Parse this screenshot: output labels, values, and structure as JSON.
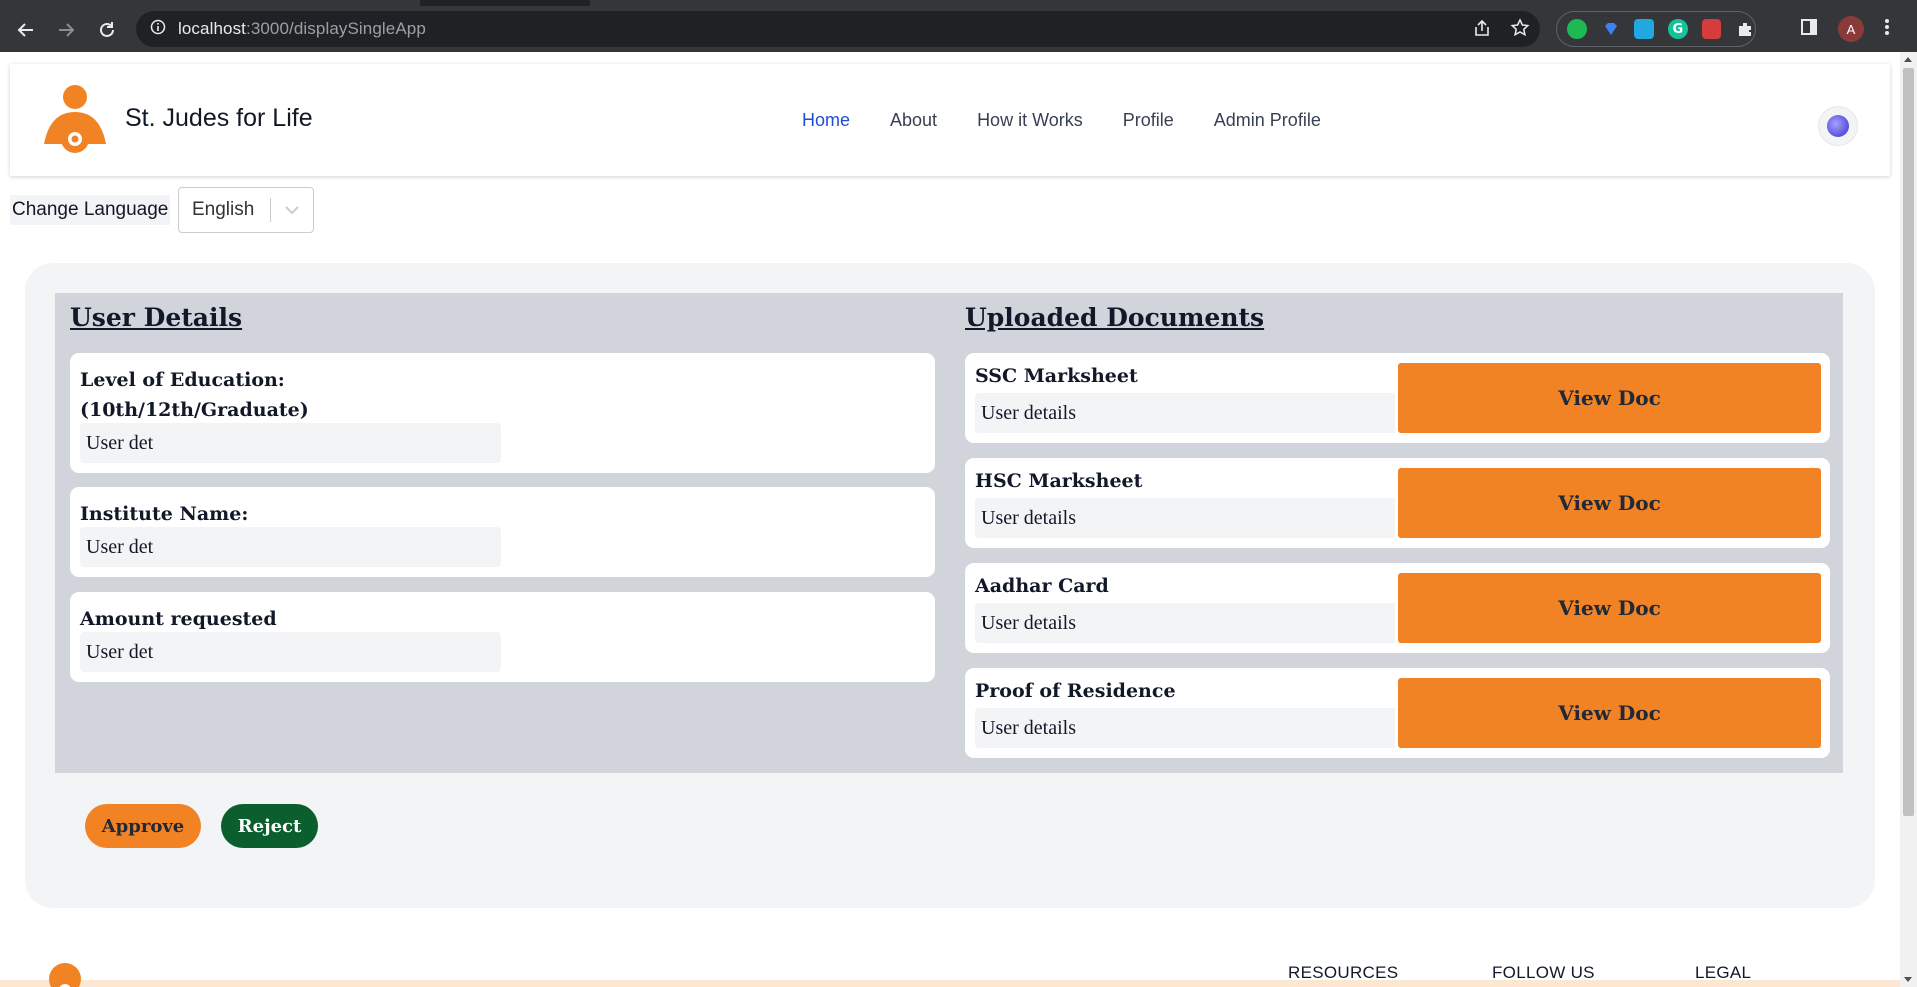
{
  "browser": {
    "url_host": "localhost",
    "url_rest": ":3000/displaySingleApp",
    "profile_initial": "A"
  },
  "header": {
    "brand": "St. Judes for Life",
    "nav": [
      "Home",
      "About",
      "How it Works",
      "Profile",
      "Admin Profile"
    ],
    "active_nav": "Home",
    "accent_color": "#1d4ed8"
  },
  "language": {
    "label": "Change Language",
    "selected": "English"
  },
  "user_details": {
    "title": "User Details",
    "fields": [
      {
        "label": "Level of Education: (10th/12th/Graduate)",
        "value": "User det"
      },
      {
        "label": "Institute Name:",
        "value": "User det"
      },
      {
        "label": "Amount requested",
        "value": "User det"
      }
    ]
  },
  "documents": {
    "title": "Uploaded Documents",
    "items": [
      {
        "label": "SSC Marksheet",
        "value": "User details",
        "button": "View Doc"
      },
      {
        "label": "HSC Marksheet",
        "value": "User details",
        "button": "View Doc"
      },
      {
        "label": "Aadhar Card",
        "value": "User details",
        "button": "View Doc"
      },
      {
        "label": "Proof of Residence",
        "value": "User details",
        "button": "View Doc"
      }
    ]
  },
  "actions": {
    "approve": "Approve",
    "reject": "Reject"
  },
  "footer": {
    "columns": [
      "RESOURCES",
      "FOLLOW US",
      "LEGAL"
    ]
  },
  "colors": {
    "primary_orange": "#f28324",
    "reject_green": "#0b5e2e"
  }
}
